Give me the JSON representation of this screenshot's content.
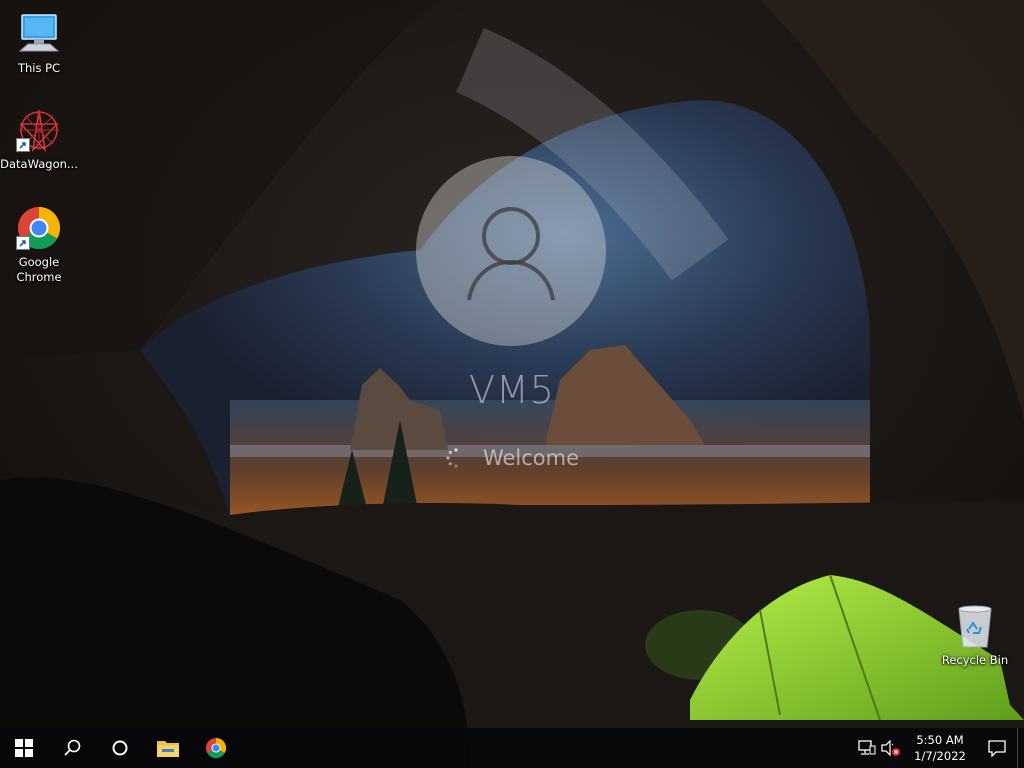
{
  "desktop": {
    "icons": [
      {
        "label": "This PC",
        "icon": "this-pc-icon"
      },
      {
        "label": "DataWagon...",
        "icon": "datawagon-icon"
      },
      {
        "label": "Google\nChrome",
        "icon": "chrome-icon"
      },
      {
        "label": "Recycle Bin",
        "icon": "recycle-bin-icon"
      }
    ]
  },
  "login": {
    "username": "VM5",
    "status": "Welcome"
  },
  "taskbar": {
    "buttons": [
      "start-icon",
      "search-icon",
      "cortana-icon",
      "file-explorer-icon",
      "chrome-icon"
    ],
    "tray": {
      "icons": [
        "network-icon",
        "volume-muted-icon"
      ],
      "time": "5:50 AM",
      "date": "1/7/2022"
    }
  },
  "colors": {
    "taskbar_bg": "#0a0a0c",
    "tent_green": "#8fd12a",
    "folder_yellow": "#f0c040"
  }
}
